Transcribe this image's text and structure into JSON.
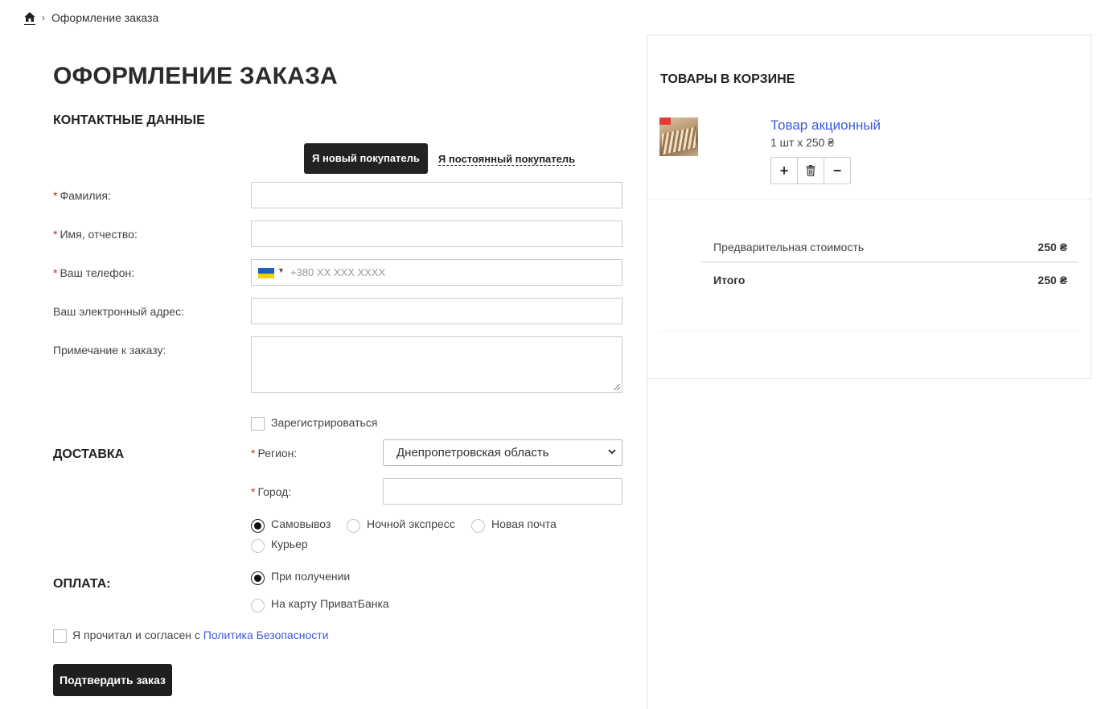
{
  "breadcrumb": {
    "current": "Оформление заказа",
    "separator": "›"
  },
  "page_title": "ОФОРМЛЕНИЕ ЗАКАЗА",
  "contacts": {
    "title": "КОНТАКТНЫЕ ДАННЫЕ",
    "tab_new": "Я новый покупатель",
    "tab_returning": "Я постоянный покупатель",
    "required_mark": "*",
    "surname_label": "Фамилия:",
    "name_label": "Имя, отчество:",
    "phone_label": "Ваш телефон:",
    "phone_placeholder": "+380 XX XXX XXXX",
    "email_label": "Ваш электронный адрес:",
    "note_label": "Примечание к заказу:",
    "register_label": "Зарегистрироваться"
  },
  "delivery": {
    "title": "ДОСТАВКА",
    "region_label": "Регион:",
    "region_value": "Днепропетровская область",
    "city_label": "Город:",
    "options": [
      "Самовывоз",
      "Ночной экспресс",
      "Новая почта",
      "Курьер"
    ],
    "selected": "Самовывоз"
  },
  "payment": {
    "title": "ОПЛАТА:",
    "options": [
      "При получении",
      "На карту ПриватБанка"
    ],
    "selected": "При получении"
  },
  "agreement": {
    "text": "Я прочитал и согласен с",
    "link": "Политика Безопасности"
  },
  "confirm_label": "Подтвердить заказ",
  "cart": {
    "title": "ТОВАРЫ В КОРЗИНЕ",
    "item": {
      "name": "Товар акционный",
      "qty_price": "1 шт x 250 ₴",
      "buttons": {
        "plus": "+",
        "delete": "🗑",
        "minus": "−"
      }
    },
    "subtotal_label": "Предварительная стоимость",
    "subtotal_value": "250 ₴",
    "total_label": "Итого",
    "total_value": "250 ₴"
  },
  "colors": {
    "accent_link": "#3d5ad8",
    "required": "#c62828",
    "button_dark": "#1f1f1f"
  },
  "icons": {
    "home": "home-icon",
    "flag": "ua-flag-icon",
    "trash": "trash-icon"
  }
}
